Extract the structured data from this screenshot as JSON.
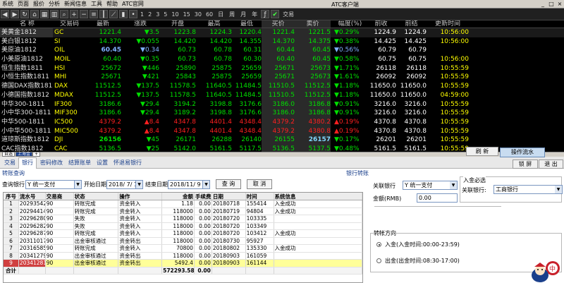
{
  "menu": [
    "系统",
    "页面",
    "报价",
    "分析",
    "新闻信息",
    "工具",
    "帮助",
    "ATC官网"
  ],
  "window_title": "ATC客户端",
  "toolbar_numbers": [
    "1",
    "2",
    "3",
    "5",
    "10",
    "15",
    "30",
    "60"
  ],
  "toolbar_periods": [
    "日",
    "周",
    "月",
    "年"
  ],
  "toolbar_trade": "交易",
  "quote_headers": [
    "名 称",
    "交易码",
    "最新",
    "涨跌",
    "开盘",
    "最高",
    "最低",
    "买价",
    "卖价",
    "幅度(%)",
    "前收",
    "前结",
    "更新时间"
  ],
  "quotes": [
    {
      "name": "美黄金1812",
      "code": "GC",
      "last": "1221.4",
      "chg": "▼3.5",
      "open": "1223.8",
      "high": "1224.3",
      "low": "1220.4",
      "bid": "1221.4",
      "ask": "1221.5",
      "pct": "▼0.29%",
      "prev_close": "1224.9",
      "prev_settle": "1224.9",
      "time": "10:56:00",
      "dir": "down"
    },
    {
      "name": "美白银1812",
      "code": "SI",
      "last": "14.370",
      "chg": "▼0.055",
      "open": "14.420",
      "high": "14.420",
      "low": "14.355",
      "bid": "14.370",
      "ask": "14.375",
      "pct": "▼0.38%",
      "prev_close": "14.425",
      "prev_settle": "14.425",
      "time": "10:56:00",
      "dir": "down"
    },
    {
      "name": "美原油1812",
      "code": "OIL",
      "last": "60.45",
      "chg": "▼0.34",
      "open": "60.73",
      "high": "60.78",
      "low": "60.31",
      "bid": "60.44",
      "ask": "60.45",
      "pct": "▼0.56%",
      "prev_close": "60.79",
      "prev_settle": "60.79",
      "time": "",
      "dir": "down"
    },
    {
      "name": "小美原油1812",
      "code": "MOIL",
      "last": "60.40",
      "chg": "▼0.35",
      "open": "60.73",
      "high": "60.78",
      "low": "60.30",
      "bid": "60.40",
      "ask": "60.45",
      "pct": "▼0.58%",
      "prev_close": "60.75",
      "prev_settle": "60.75",
      "time": "10:56:00",
      "dir": "down"
    },
    {
      "name": "恒生指数1811",
      "code": "HSI",
      "last": "25672",
      "chg": "▼446",
      "open": "25890",
      "high": "25875",
      "low": "25659",
      "bid": "25671",
      "ask": "25673",
      "pct": "▼1.71%",
      "prev_close": "26118",
      "prev_settle": "26118",
      "time": "10:55:59",
      "dir": "down"
    },
    {
      "name": "小恒生指数1811",
      "code": "MHI",
      "last": "25671",
      "chg": "▼421",
      "open": "25843",
      "high": "25875",
      "low": "25659",
      "bid": "25671",
      "ask": "25673",
      "pct": "▼1.61%",
      "prev_close": "26092",
      "prev_settle": "26092",
      "time": "10:55:59",
      "dir": "down"
    },
    {
      "name": "德国DAX指数1812",
      "code": "DAX",
      "last": "11512.5",
      "chg": "▼137.5",
      "open": "11578.5",
      "high": "11640.5",
      "low": "11484.5",
      "bid": "11510.5",
      "ask": "11512.5",
      "pct": "▼1.18%",
      "prev_close": "11650.0",
      "prev_settle": "11650.0",
      "time": "10:55:59",
      "dir": "down"
    },
    {
      "name": "小德国指数1812",
      "code": "MDAX",
      "last": "11512.5",
      "chg": "▼137.5",
      "open": "11578.5",
      "high": "11640.5",
      "low": "11484.5",
      "bid": "11510.5",
      "ask": "11512.5",
      "pct": "▼1.18%",
      "prev_close": "11650.0",
      "prev_settle": "11650.0",
      "time": "04:59:00",
      "dir": "down"
    },
    {
      "name": "中华300-1811",
      "code": "IF300",
      "last": "3186.6",
      "chg": "▼29.4",
      "open": "3194.2",
      "high": "3198.8",
      "low": "3176.6",
      "bid": "3186.0",
      "ask": "3186.8",
      "pct": "▼0.91%",
      "prev_close": "3216.0",
      "prev_settle": "3216.0",
      "time": "10:55:59",
      "dir": "down"
    },
    {
      "name": "小中华300-1811",
      "code": "MIF300",
      "last": "3186.6",
      "chg": "▼29.4",
      "open": "3189.2",
      "high": "3198.8",
      "low": "3176.6",
      "bid": "3186.0",
      "ask": "3186.8",
      "pct": "▼0.91%",
      "prev_close": "3216.0",
      "prev_settle": "3216.0",
      "time": "10:55:59",
      "dir": "down"
    },
    {
      "name": "中华500-1811",
      "code": "IC500",
      "last": "4379.2",
      "chg": "▲8.4",
      "open": "4347.8",
      "high": "4401.4",
      "low": "4348.4",
      "bid": "4379.2",
      "ask": "4380.2",
      "pct": "▲0.19%",
      "prev_close": "4370.8",
      "prev_settle": "4370.8",
      "time": "10:55:59",
      "dir": "up"
    },
    {
      "name": "小中华500-1811",
      "code": "MIC500",
      "last": "4379.2",
      "chg": "▲8.4",
      "open": "4347.8",
      "high": "4401.4",
      "low": "4348.4",
      "bid": "4379.2",
      "ask": "4380.8",
      "pct": "▲0.19%",
      "prev_close": "4370.8",
      "prev_settle": "4370.8",
      "time": "10:55:59",
      "dir": "up"
    },
    {
      "name": "道琼斯指数1812",
      "code": "DJI",
      "last": "26156",
      "chg": "▼45",
      "open": "26171",
      "high": "26288",
      "low": "26140",
      "bid": "26155",
      "ask": "26157",
      "pct": "▼0.17%",
      "prev_close": "26201",
      "prev_settle": "26201",
      "time": "10:55:59",
      "dir": "down"
    },
    {
      "name": "CAC指数1812",
      "code": "CAC",
      "last": "5136.5",
      "chg": "▼25",
      "open": "5142.0",
      "high": "5161.5",
      "low": "5117.5",
      "bid": "5136.5",
      "ask": "5137.5",
      "pct": "▼0.48%",
      "prev_close": "5161.5",
      "prev_settle": "5161.5",
      "time": "10:55:59",
      "dir": "down"
    }
  ],
  "mid_tabs": [
    "自选",
    "上海金",
    "+"
  ],
  "bottom_tabs": [
    "交易",
    "银行",
    "密码修改",
    "结算账单",
    "设置",
    "怀退易银行"
  ],
  "bottom_right_buttons": [
    "刷 新",
    "操作流水",
    "锁 屏",
    "退 出"
  ],
  "transfer_query_label": "转账查询",
  "filter": {
    "bank_label": "查询银行",
    "bank_value": "Y 统一支付",
    "start_label": "开始日期",
    "start_value": "2018/ 7/ 1",
    "end_label": "结束日期",
    "end_value": "2018/11/ 9",
    "query_btn": "查 询",
    "cancel_btn": "取 消"
  },
  "grid_headers": [
    "序号",
    "流水号",
    "交易商",
    "状态",
    "操作",
    "金额",
    "手续费",
    "日期",
    "时间",
    "系统信息"
  ],
  "grid_rows": [
    [
      "1",
      "20293542",
      "90",
      "转账完成",
      "资金转入",
      "1.18",
      "0.00",
      "20180718",
      "155414",
      "入金成功"
    ],
    [
      "2",
      "20294414",
      "90",
      "转账完成",
      "资金转入",
      "118000",
      "0.00",
      "20180719",
      "94804",
      "入金成功"
    ],
    [
      "3",
      "20296280",
      "90",
      "失败",
      "资金转入",
      "118000",
      "0.00",
      "20180720",
      "103335",
      ""
    ],
    [
      "4",
      "20296282",
      "90",
      "失败",
      "资金转入",
      "118000",
      "0.00",
      "20180720",
      "103349",
      ""
    ],
    [
      "5",
      "20296287",
      "90",
      "转账完成",
      "资金转入",
      "118000",
      "0.00",
      "20180720",
      "103412",
      "入金成功"
    ],
    [
      "6",
      "20311017",
      "90",
      "出金审核通过",
      "资金转出",
      "118000",
      "0.00",
      "20180730",
      "95927",
      ""
    ],
    [
      "7",
      "20316585",
      "90",
      "转账完成",
      "资金转入",
      "70800",
      "0.00",
      "20180802",
      "135330",
      "入金成功"
    ],
    [
      "8",
      "20341279",
      "90",
      "出金审核通过",
      "资金转出",
      "118000",
      "0.00",
      "20180903",
      "161059",
      ""
    ],
    [
      "9",
      "20341281",
      "90",
      "出金审核通过",
      "资金转出",
      "5492.4",
      "0.00",
      "20180903",
      "161144",
      ""
    ]
  ],
  "grid_total": {
    "label": "合计",
    "amount": "572293.58",
    "fee": "0.00"
  },
  "right": {
    "section_label": "银行转账",
    "bank_label": "关联银行",
    "bank_value": "Y 统一支付",
    "amount_label": "金额(RMB)",
    "amount_value": "0.00",
    "entry_label": "入金必选",
    "entry_bank_label": "关联银行:",
    "entry_bank_value": "工商银行",
    "direction_label": "转帐方向",
    "radio_in": "入金(入金时间:00:00-23:59)",
    "radio_out": "出金(出金时间:08:30-17:00)"
  },
  "colors": {
    "down": "#00e000",
    "up": "#ff2020",
    "code": "#ffff00",
    "name": "#e0e0e0",
    "neutral": "#ffffff",
    "time": "#ffff00"
  },
  "mascot_icon": "mascot-icon"
}
